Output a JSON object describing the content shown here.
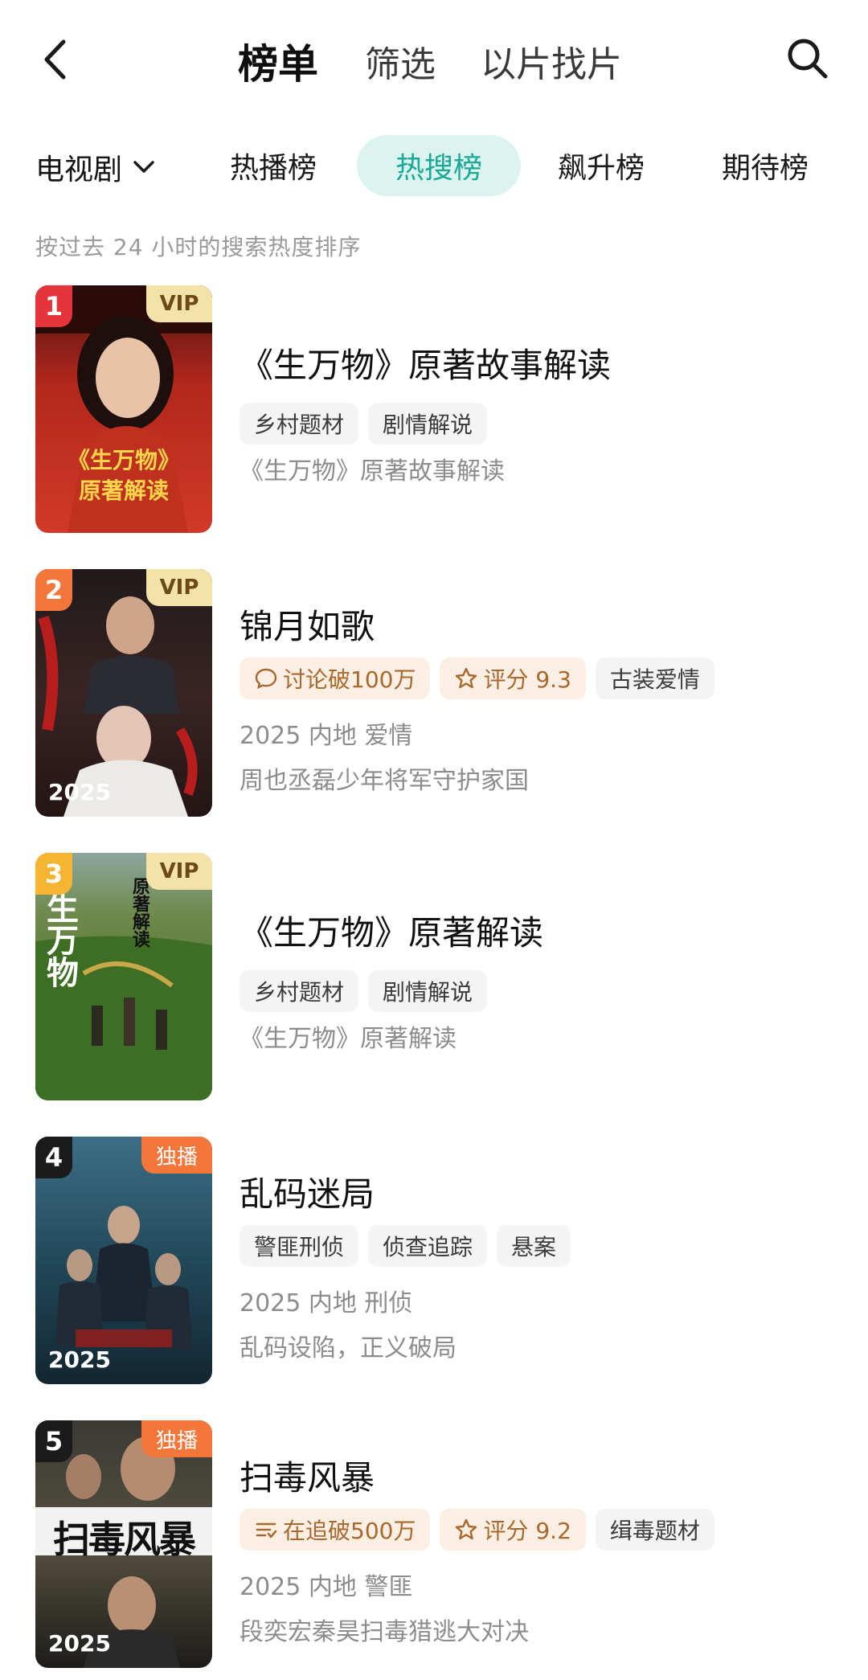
{
  "header": {
    "tabs": [
      {
        "label": "榜单"
      },
      {
        "label": "筛选"
      },
      {
        "label": "以片找片"
      }
    ]
  },
  "category": {
    "selected": "电视剧",
    "tabs": [
      {
        "label": "热播榜"
      },
      {
        "label": "热搜榜"
      },
      {
        "label": "飙升榜"
      },
      {
        "label": "期待榜"
      }
    ]
  },
  "subtitle": "按过去 24 小时的搜索热度排序",
  "items": [
    {
      "rank": "1",
      "badge": "VIP",
      "title": "《生万物》原著故事解读",
      "tags": [
        "乡村题材",
        "剧情解说"
      ],
      "desc": "《生万物》原著故事解读",
      "poster_text": [
        "《生万物》",
        "原著解读"
      ]
    },
    {
      "rank": "2",
      "badge": "VIP",
      "poster_year": "2025",
      "title": "锦月如歌",
      "hot_tags": [
        "讨论破100万",
        "评分 9.3"
      ],
      "tags": [
        "古装爱情"
      ],
      "meta": "2025 内地 爱情",
      "desc": "周也丞磊少年将军守护家国"
    },
    {
      "rank": "3",
      "badge": "VIP",
      "title": "《生万物》原著解读",
      "tags": [
        "乡村题材",
        "剧情解说"
      ],
      "desc": "《生万物》原著解读",
      "poster_text": [
        "生万物",
        "原著解读"
      ]
    },
    {
      "rank": "4",
      "badge": "独播",
      "poster_year": "2025",
      "title": "乱码迷局",
      "tags": [
        "警匪刑侦",
        "侦查追踪",
        "悬案"
      ],
      "meta": "2025 内地 刑侦",
      "desc": "乱码设陷，正义破局"
    },
    {
      "rank": "5",
      "badge": "独播",
      "poster_year": "2025",
      "title": "扫毒风暴",
      "hot_tags": [
        "在追破500万",
        "评分 9.2"
      ],
      "tags": [
        "缉毒题材"
      ],
      "meta": "2025 内地 警匪",
      "desc": "段奕宏秦昊扫毒猎逃大对决",
      "poster_text": [
        "扫毒风暴"
      ]
    }
  ],
  "colors": {
    "accent": "#1aa997",
    "accent_bg": "#dcf3ef",
    "rank1": "#e5343a",
    "rank2": "#f3763b",
    "rank3": "#f5b533",
    "rank_other": "#1b1b1b",
    "vip_bg": "#f4e3a9",
    "excl_bg": "#f3763b"
  }
}
